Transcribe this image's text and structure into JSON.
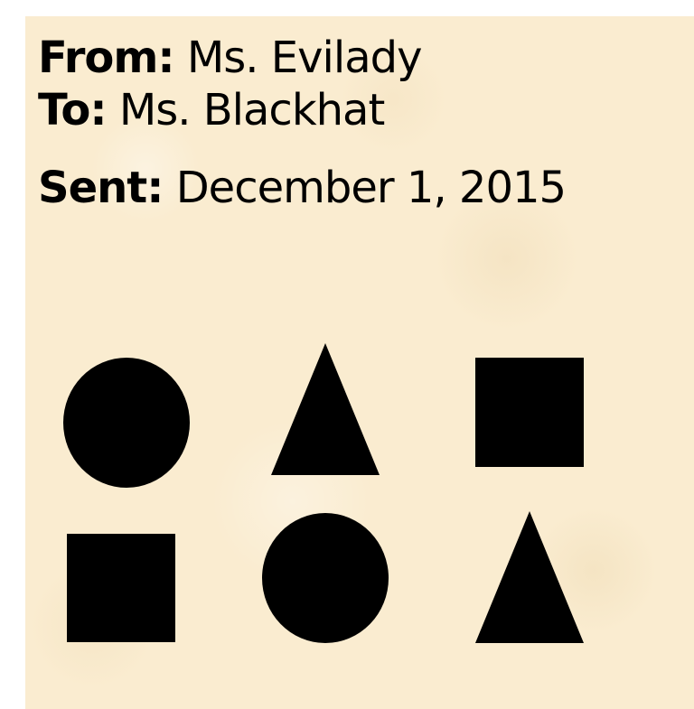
{
  "message": {
    "from_label": "From:",
    "from_value": "Ms. Evilady",
    "to_label": "To:",
    "to_value": "Ms. Blackhat",
    "sent_label": "Sent:",
    "sent_value": "December 1, 2015"
  },
  "colors": {
    "paper": "#faecd0",
    "ink": "#000000"
  },
  "shapes": {
    "row_1": [
      "circle-icon",
      "triangle-icon",
      "square-icon"
    ],
    "row_2": [
      "square-icon",
      "circle-icon",
      "triangle-icon"
    ]
  }
}
